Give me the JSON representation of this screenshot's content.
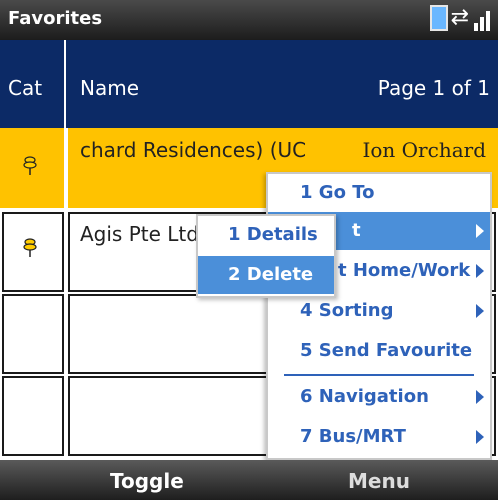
{
  "window": {
    "title": "Favorites"
  },
  "status_icons": [
    "battery-icon",
    "connection-icon",
    "signal-icon"
  ],
  "header": {
    "cat": "Cat",
    "name": "Name",
    "page": "Page 1 of 1"
  },
  "rows": [
    {
      "name": "chard Residences) (UC",
      "location": "Ion Orchard",
      "icon": "pin-icon",
      "selected": true
    },
    {
      "name": "Agis Pte Ltd",
      "location": "",
      "icon": "pin-icon",
      "selected": false
    },
    {
      "name": "",
      "location": "",
      "icon": "",
      "selected": false
    },
    {
      "name": "",
      "location": "",
      "icon": "",
      "selected": false
    }
  ],
  "menu": {
    "items": [
      {
        "label": "1 Go To",
        "submenu": false
      },
      {
        "label": "t",
        "submenu": true,
        "highlighted": true
      },
      {
        "label": "t Home/Work",
        "submenu": true
      },
      {
        "label": "4 Sorting",
        "submenu": true
      },
      {
        "label": "5 Send Favourite",
        "submenu": false
      },
      {
        "label": "6 Navigation",
        "submenu": true
      },
      {
        "label": "7 Bus/MRT",
        "submenu": true
      }
    ]
  },
  "submenu": {
    "items": [
      {
        "label": "1 Details",
        "highlighted": false
      },
      {
        "label": "2 Delete",
        "highlighted": true
      }
    ]
  },
  "softkeys": {
    "left": "Toggle",
    "right": "Menu"
  },
  "colors": {
    "header_bg": "#0c2a66",
    "selected_row": "#ffc200",
    "menu_text": "#2e62b9",
    "menu_highlight": "#4b8fd9"
  }
}
